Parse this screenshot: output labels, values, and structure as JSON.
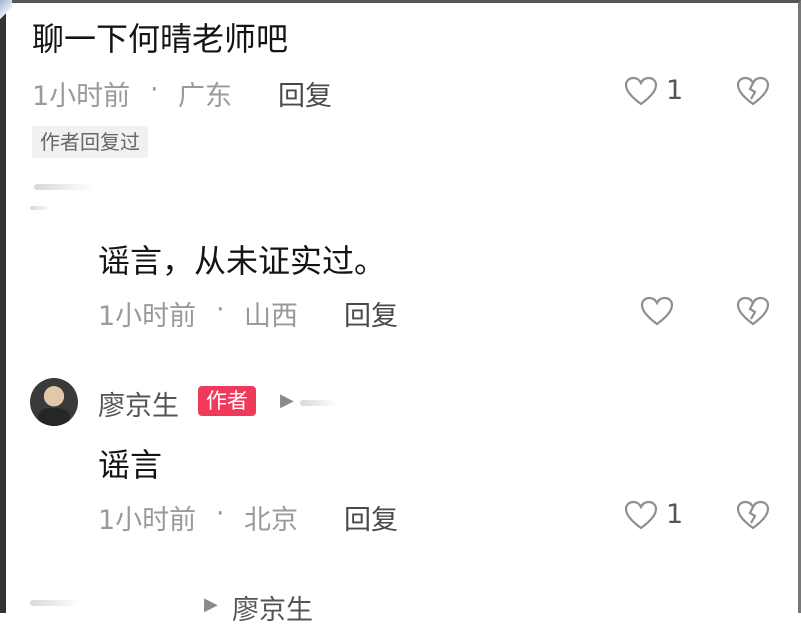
{
  "comments": [
    {
      "text": "聊一下何晴老师吧",
      "time": "1小时前",
      "location": "广东",
      "reply_label": "回复",
      "likes": "1",
      "tag": "作者回复过"
    },
    {
      "text": "谣言，从未证实过。",
      "time": "1小时前",
      "location": "山西",
      "reply_label": "回复",
      "likes": ""
    },
    {
      "author": "廖京生",
      "author_badge": "作者",
      "text": "谣言",
      "time": "1小时前",
      "location": "北京",
      "reply_label": "回复",
      "likes": "1"
    }
  ],
  "bottom_reply": {
    "author": "廖京生"
  },
  "separator": "·",
  "colors": {
    "badge": "#f03a5c",
    "meta": "#9a9a9a"
  }
}
